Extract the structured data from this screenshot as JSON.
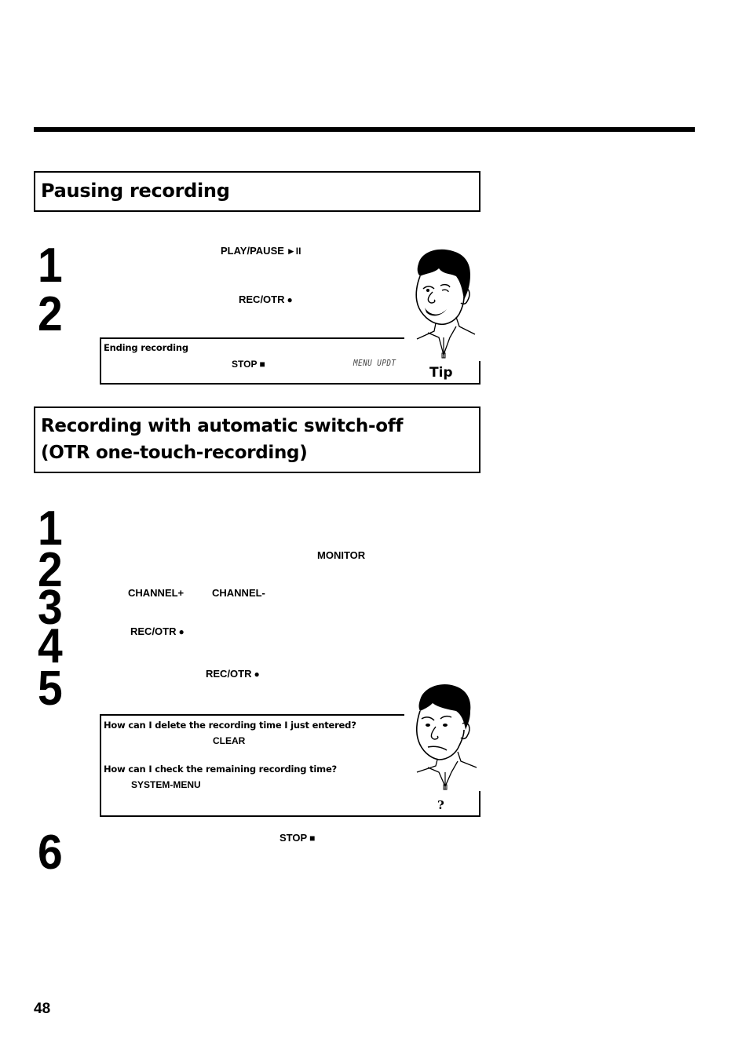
{
  "header": {
    "rule": "top-horizontal-rule"
  },
  "sections": [
    {
      "title": "Pausing recording",
      "steps": [
        {
          "number": "1",
          "keys": [
            {
              "label": "PLAY/PAUSE",
              "glyph": "►II",
              "icon": "play-pause-icon"
            }
          ]
        },
        {
          "number": "2",
          "keys": [
            {
              "label": "REC/OTR",
              "glyph": "●",
              "icon": "record-dot-icon"
            }
          ]
        }
      ],
      "tip": {
        "heading": "Ending recording",
        "key": {
          "label": "STOP",
          "glyph": "■",
          "icon": "stop-square-icon"
        },
        "display_text": "MENU UPDT",
        "label": "Tip",
        "illustration": "smiling-man-cartoon"
      }
    },
    {
      "title_line1": "Recording with automatic switch-off",
      "title_line2": "(OTR one-touch-recording)",
      "steps": [
        {
          "number": "1",
          "keys": []
        },
        {
          "number": "2",
          "keys": [
            {
              "label": "MONITOR"
            }
          ]
        },
        {
          "number": "3",
          "keys": [
            {
              "label": "CHANNEL+"
            },
            {
              "label": "CHANNEL-"
            }
          ]
        },
        {
          "number": "4",
          "keys": [
            {
              "label": "REC/OTR",
              "glyph": "●",
              "icon": "record-dot-icon"
            }
          ]
        },
        {
          "number": "5",
          "keys": [
            {
              "label": "REC/OTR",
              "glyph": "●",
              "icon": "record-dot-icon"
            }
          ]
        },
        {
          "number": "6",
          "keys": [
            {
              "label": "STOP",
              "glyph": "■",
              "icon": "stop-square-icon"
            }
          ]
        }
      ],
      "faq": {
        "q1": "How can I delete the recording time I just entered?",
        "a1_key": "CLEAR",
        "q2": "How can I check the remaining recording time?",
        "a2_key": "SYSTEM-MENU",
        "label": "?",
        "illustration": "puzzled-man-cartoon"
      }
    }
  ],
  "footer": {
    "page_number": "48"
  }
}
